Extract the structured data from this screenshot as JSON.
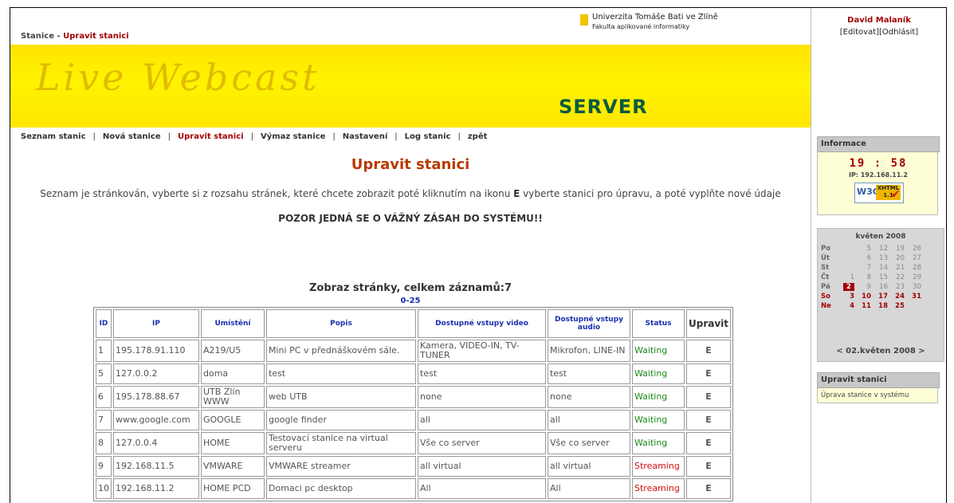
{
  "breadcrumb": {
    "root": "Stanice",
    "sep": " - ",
    "current": "Upravit stanici"
  },
  "university": {
    "name": "Univerzita Tomáše Bati ve Zlíně",
    "faculty": "Fakulta aplikované informatiky"
  },
  "banner": {
    "title": "Live Webcast",
    "subtitle": "SERVER"
  },
  "nav": {
    "items": [
      "Seznam stanic",
      "Nová stanice",
      "Upravit stanici",
      "Výmaz stanice",
      "Nastavení",
      "Log stanic",
      "zpět"
    ],
    "active": "Upravit stanici",
    "sep": "|"
  },
  "page": {
    "title": "Upravit stanici",
    "desc_before": "Seznam je stránkován, vyberte si z rozsahu stránek, které chcete zobrazit poté kliknutím na ikonu ",
    "desc_icon": "E",
    "desc_after": " vyberte stanici pro úpravu, a poté vyplňte nové údaje",
    "warning": "POZOR JEDNÁ SE O VÁŽNÝ ZÁSAH DO SYSTÉMU!!",
    "pager_title": "Zobraz stránky, celkem záznamů:7",
    "pager_range": "0-25"
  },
  "table": {
    "headers": [
      "ID",
      "IP",
      "Umístění",
      "Popis",
      "Dostupné vstupy video",
      "Dostupné vstupy audio",
      "Status",
      "Upravit"
    ],
    "rows": [
      {
        "id": "1",
        "ip": "195.178.91.110",
        "location": "A219/U5",
        "desc": "Mini PC v přednáškovém sále.",
        "video": "Kamera, VIDEO-IN, TV-TUNER",
        "audio": "Mikrofon, LINE-IN",
        "status": "Waiting",
        "edit": "E"
      },
      {
        "id": "5",
        "ip": "127.0.0.2",
        "location": "doma",
        "desc": "test",
        "video": "test",
        "audio": "test",
        "status": "Waiting",
        "edit": "E"
      },
      {
        "id": "6",
        "ip": "195.178.88.67",
        "location": "UTB Zlín WWW",
        "desc": "web UTB",
        "video": "none",
        "audio": "none",
        "status": "Waiting",
        "edit": "E"
      },
      {
        "id": "7",
        "ip": "www.google.com",
        "location": "GOOGLE",
        "desc": "google finder",
        "video": "all",
        "audio": "all",
        "status": "Waiting",
        "edit": "E"
      },
      {
        "id": "8",
        "ip": "127.0.0.4",
        "location": "HOME",
        "desc": "Testovací stanice na virtual serveru",
        "video": "Vše co server",
        "audio": "Vše co server",
        "status": "Waiting",
        "edit": "E"
      },
      {
        "id": "9",
        "ip": "192.168.11.5",
        "location": "VMWARE",
        "desc": "VMWARE streamer",
        "video": "all virtual",
        "audio": "all virtual",
        "status": "Streaming",
        "edit": "E"
      },
      {
        "id": "10",
        "ip": "192.168.11.2",
        "location": "HOME PCD",
        "desc": "Domaci pc desktop",
        "video": "All",
        "audio": "All",
        "status": "Streaming",
        "edit": "E"
      }
    ]
  },
  "sidebar": {
    "user": "David Malaník",
    "actions": [
      "[Editovat]",
      "[Odhlásit]"
    ],
    "info_title": "Informace",
    "clock": "19 : 58",
    "ip": "IP: 192.168.11.2",
    "badge": {
      "w3c": "W3C",
      "xhtml": "XHTML",
      "version": "1.1",
      "check": "✔"
    },
    "calendar": {
      "title": "květen 2008",
      "rows": [
        {
          "day": "Po",
          "dates": [
            "",
            "5",
            "12",
            "19",
            "26"
          ]
        },
        {
          "day": "Út",
          "dates": [
            "",
            "6",
            "13",
            "20",
            "27"
          ]
        },
        {
          "day": "St",
          "dates": [
            "",
            "7",
            "14",
            "21",
            "28"
          ]
        },
        {
          "day": "Čt",
          "dates": [
            "1",
            "8",
            "15",
            "22",
            "29"
          ]
        },
        {
          "day": "Pá",
          "dates": [
            "2",
            "9",
            "16",
            "23",
            "30"
          ]
        },
        {
          "day": "So",
          "dates": [
            "3",
            "10",
            "17",
            "24",
            "31"
          ]
        },
        {
          "day": "Ne",
          "dates": [
            "4",
            "11",
            "18",
            "25",
            ""
          ]
        }
      ],
      "today": "2",
      "nav": "< 02.květen 2008 >"
    },
    "edit_box": {
      "title": "Upravit stanici",
      "text": "Úprava stanice v systému"
    }
  },
  "colors": {
    "accent": "#a20000",
    "banner": "#fff300",
    "waiting": "#1b8a1b",
    "streaming": "#d21010",
    "link": "#1a2fb0"
  }
}
